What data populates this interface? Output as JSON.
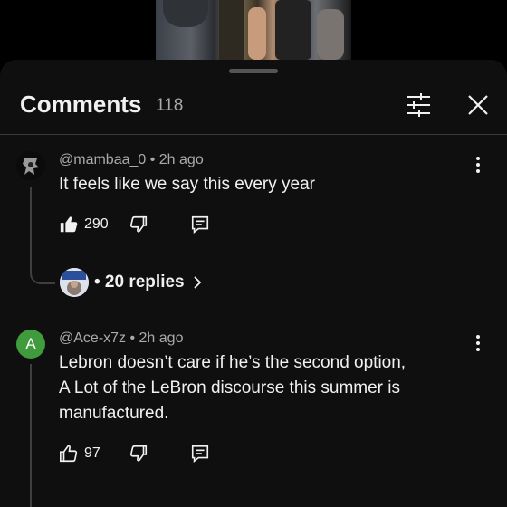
{
  "header": {
    "title": "Comments",
    "count": "118"
  },
  "comments": [
    {
      "meta": "@mambaa_0 • 2h ago",
      "lines": [
        "It feels like we say this every year"
      ],
      "likes": "290",
      "replies_label": "• 20 replies"
    },
    {
      "meta": "@Ace-x7z • 2h ago",
      "avatar_letter": "A",
      "avatar_color": "#3f9b3b",
      "lines": [
        "Lebron doesn’t care if he’s the second option,",
        "A Lot of the LeBron discourse this summer is",
        "manufactured."
      ],
      "likes": "97"
    }
  ],
  "icons": {
    "filter": "filter-sliders-icon",
    "close": "close-icon",
    "more": "more-vert-icon",
    "like": "thumb-up-icon",
    "dislike": "thumb-down-icon",
    "reply": "reply-comment-icon",
    "chevron": "chevron-right-icon"
  },
  "colors": {
    "sheet_bg": "#0f0f0f",
    "text": "#f1f1f1",
    "secondary_text": "#aaaaaa"
  }
}
